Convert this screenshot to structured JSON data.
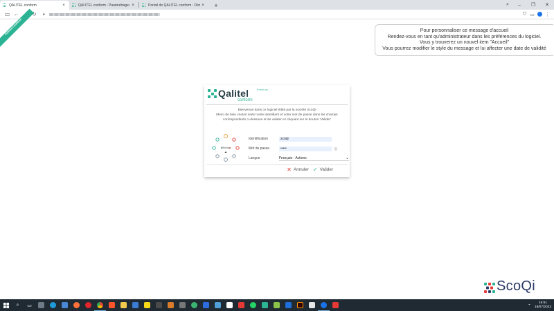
{
  "browser": {
    "tabs": [
      {
        "title": "QALITEL conform",
        "active": true
      },
      {
        "title": "QALITEL conform : Paramétrage du...",
        "active": false
      },
      {
        "title": "Portail de QALITEL conform : Démo...",
        "active": false
      }
    ],
    "close_glyph": "×",
    "new_tab_glyph": "+",
    "window_controls": {
      "search": "⌕",
      "minimize": "–",
      "restore": "❐",
      "close": "✕"
    },
    "nav": {
      "back": "←",
      "forward": "→",
      "reload": "↻",
      "sidebar": "▭"
    },
    "toolbar_icons": {
      "shield": "⛉",
      "reading": "▭",
      "menu": "⋮"
    }
  },
  "ribbon": {
    "text": "Release Candidate"
  },
  "welcome_message": {
    "lines": [
      "Pour personnaliser ce message d'accueil",
      "Rendez-vous en tant qu'administrateur dans les préférences du logiciel.",
      "Vous y trouverez un nouvel item \"Accueil\"",
      "Vous pourrez modifier le style du message et  lui affecter une date de validité"
    ]
  },
  "login": {
    "logo_name": "Qalitel",
    "logo_sub": "conform",
    "edition": "Premium",
    "intro_lines": [
      "Bienvenue dans ce logiciel édité par la société ScoQi",
      "Merci de bien vouloir saisir votre identifiant et votre mot de passe dans les champs",
      "correspondants ci-dessous et de valider en cliquant sur le bouton 'Valider'"
    ],
    "cycle_center": "Efficiency",
    "fields": {
      "identification_label": "Identification",
      "identification_value": "scoqi",
      "password_label": "Mot de passe",
      "password_value": "•••••",
      "language_label": "Langue",
      "language_value": "Français - Actions"
    },
    "buttons": {
      "cancel": "Annuler",
      "validate": "Valider"
    },
    "colors": {
      "accent": "#2bb394",
      "cancel": "#e53935"
    }
  },
  "brand": {
    "name": "ScoQi"
  },
  "taskbar": {
    "clock_time": "16:51",
    "clock_date": "19/07/2023"
  }
}
